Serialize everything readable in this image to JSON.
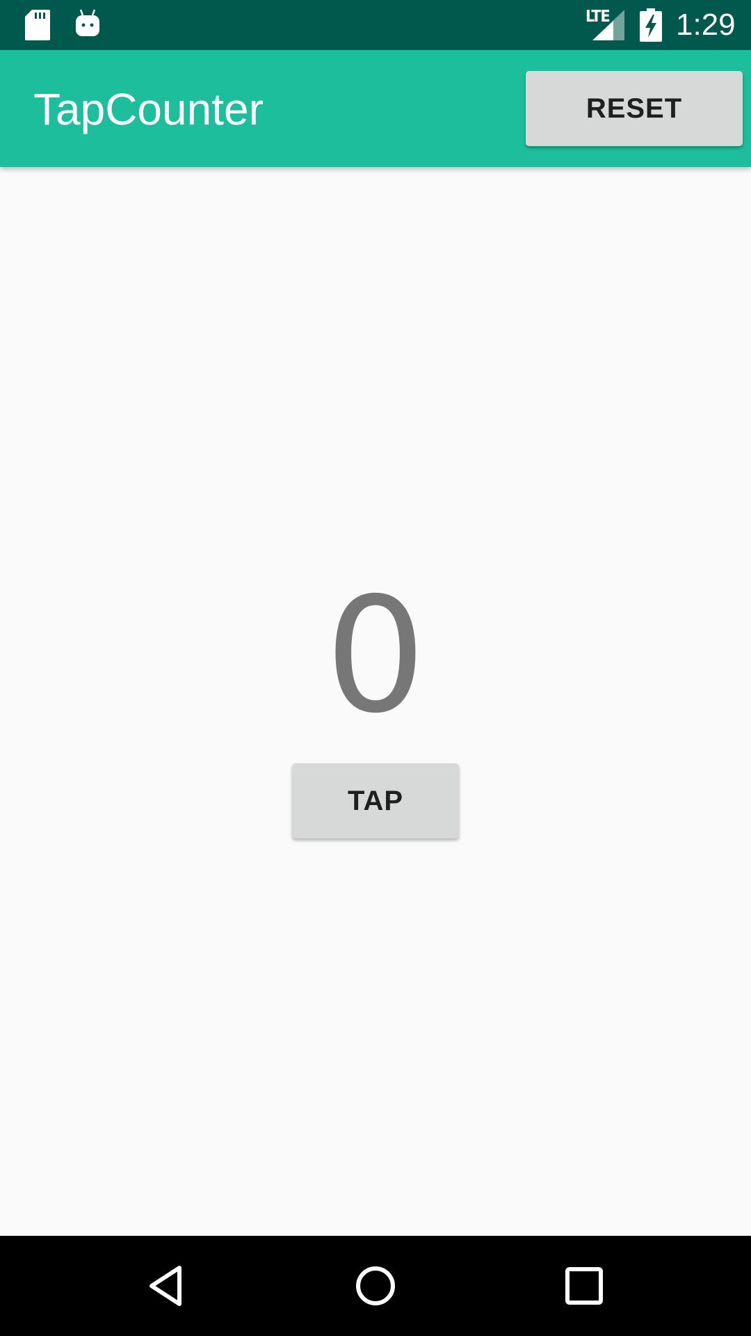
{
  "status_bar": {
    "time": "1:29",
    "network": "LTE",
    "icons": [
      "sd-card-icon",
      "android-icon",
      "signal-icon",
      "battery-charging-icon"
    ],
    "background_color": "#00594c"
  },
  "app_bar": {
    "title": "TapCounter",
    "reset_label": "RESET",
    "background_color": "#1dbe9c"
  },
  "main": {
    "counter_value": "0",
    "tap_label": "TAP"
  },
  "nav_bar": {
    "icons": [
      "back-icon",
      "home-icon",
      "recents-icon"
    ]
  }
}
